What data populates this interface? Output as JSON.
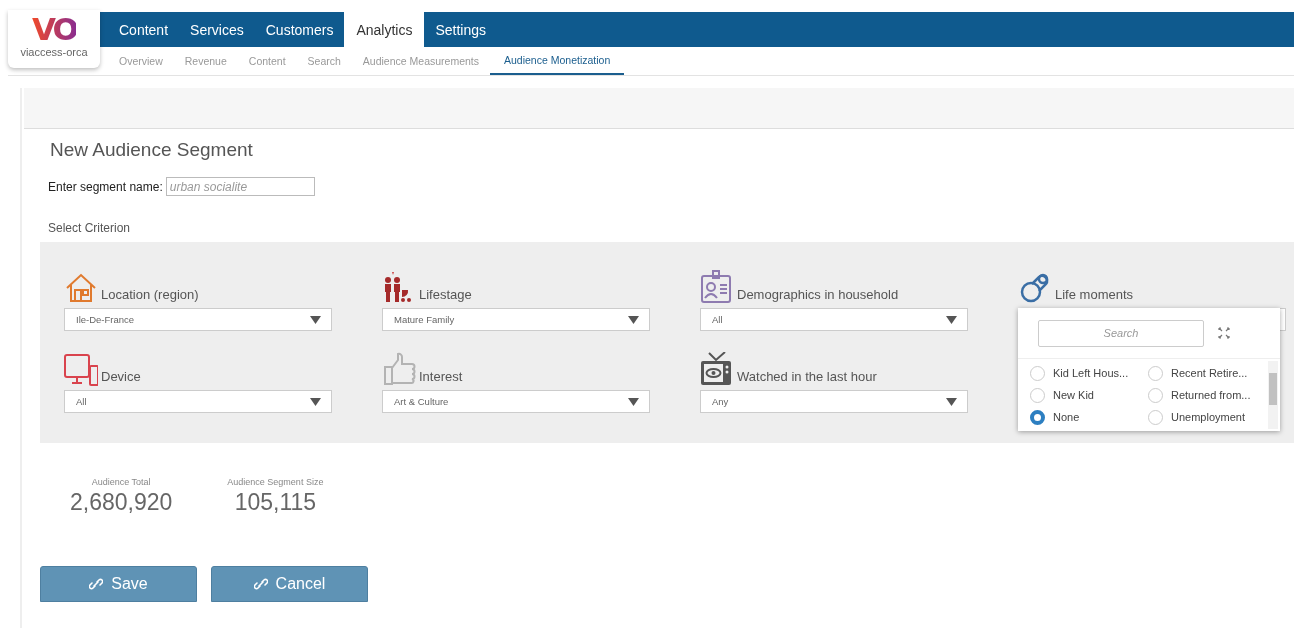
{
  "logo": {
    "mark": "VO",
    "wordmark": "viaccess-orca"
  },
  "main_tabs": [
    {
      "label": "Content",
      "selected": false
    },
    {
      "label": "Services",
      "selected": false
    },
    {
      "label": "Customers",
      "selected": false
    },
    {
      "label": "Analytics",
      "selected": true
    },
    {
      "label": "Settings",
      "selected": false
    }
  ],
  "sub_tabs": [
    {
      "label": "Overview",
      "selected": false
    },
    {
      "label": "Revenue",
      "selected": false
    },
    {
      "label": "Content",
      "selected": false
    },
    {
      "label": "Search",
      "selected": false
    },
    {
      "label": "Audience Measurements",
      "selected": false
    },
    {
      "label": "Audience Monetization",
      "selected": true
    }
  ],
  "title": "New Audience Segment",
  "segment_name": {
    "label": "Enter segment name:",
    "placeholder": "urban socialite"
  },
  "criterion_heading": "Select Criterion",
  "criteria": [
    {
      "kind": "house",
      "label": "Location (region)",
      "value": "Ile-De-France"
    },
    {
      "kind": "family",
      "label": "Lifestage",
      "value": "Mature Family"
    },
    {
      "kind": "idcard",
      "label": "Demographics in household",
      "value": "All"
    },
    {
      "kind": "pacifier",
      "label": "Life moments",
      "open": true
    },
    {
      "kind": "device",
      "label": "Device",
      "value": "All"
    },
    {
      "kind": "thumb",
      "label": "Interest",
      "value": "Art & Culture"
    },
    {
      "kind": "tv",
      "label": "Watched in the last hour",
      "value": "Any"
    }
  ],
  "life_moments_popup": {
    "search_placeholder": "Search",
    "options": [
      {
        "label": "Kid Left Hous...",
        "selected": false
      },
      {
        "label": "Recent Retire...",
        "selected": false
      },
      {
        "label": "New Kid",
        "selected": false
      },
      {
        "label": "Returned from...",
        "selected": false
      },
      {
        "label": "None",
        "selected": true
      },
      {
        "label": "Unemployment",
        "selected": false
      }
    ]
  },
  "stats": [
    {
      "label": "Audience Total",
      "value": "2,680,920"
    },
    {
      "label": "Audience Segment Size",
      "value": "105,115"
    }
  ],
  "buttons": [
    "Save",
    "Cancel"
  ]
}
